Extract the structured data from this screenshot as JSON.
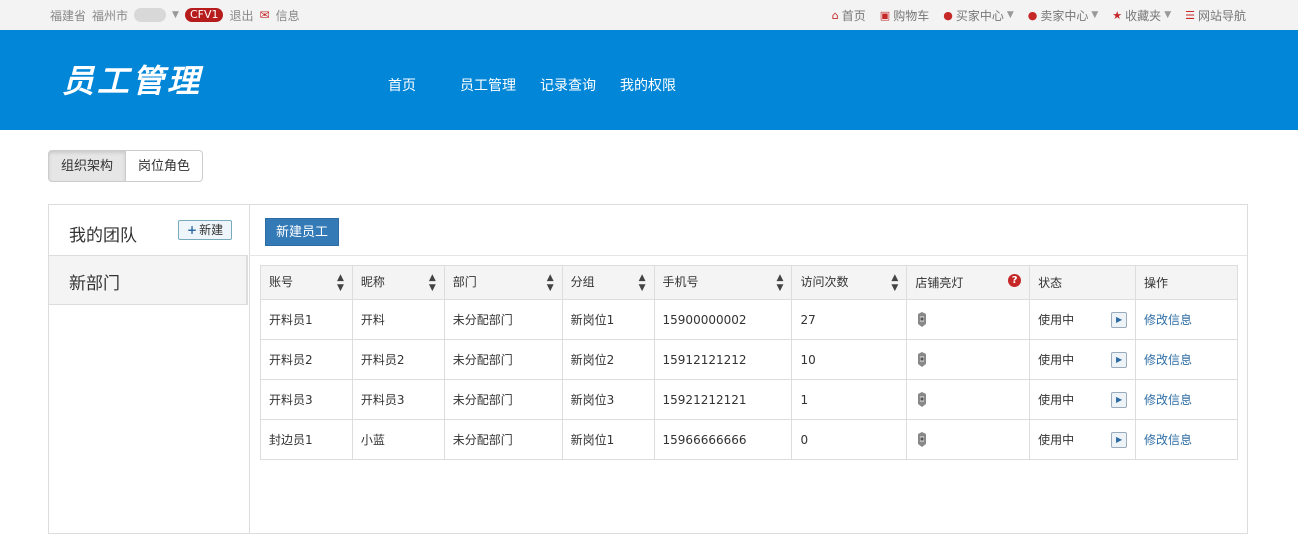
{
  "topbar": {
    "province": "福建省",
    "city": "福州市",
    "badge": "CFV1",
    "logout": "退出",
    "messages": "信息",
    "links": [
      {
        "label": "首页",
        "icon": "home-icon"
      },
      {
        "label": "购物车",
        "icon": "cart-icon"
      },
      {
        "label": "买家中心",
        "icon": "user-icon"
      },
      {
        "label": "卖家中心",
        "icon": "user-icon"
      },
      {
        "label": "收藏夹",
        "icon": "star-icon"
      },
      {
        "label": "网站导航",
        "icon": "list-icon"
      }
    ]
  },
  "header": {
    "logo": "员工管理",
    "nav": [
      "首页",
      "员工管理",
      "记录查询",
      "我的权限"
    ]
  },
  "tabs": [
    "组织架构",
    "岗位角色"
  ],
  "sidebar": {
    "title": "我的团队",
    "new_label": "新建",
    "department": "新部门"
  },
  "toolbar": {
    "add_employee": "新建员工"
  },
  "table": {
    "headers": [
      "账号",
      "昵称",
      "部门",
      "分组",
      "手机号",
      "访问次数",
      "店铺亮灯",
      "状态",
      "操作"
    ],
    "rows": [
      [
        "开料员1",
        "开料",
        "未分配部门",
        "新岗位1",
        "15900000002",
        "27",
        "",
        "使用中",
        "修改信息"
      ],
      [
        "开料员2",
        "开料员2",
        "未分配部门",
        "新岗位2",
        "15912121212",
        "10",
        "",
        "使用中",
        "修改信息"
      ],
      [
        "开料员3",
        "开料员3",
        "未分配部门",
        "新岗位3",
        "15921212121",
        "1",
        "",
        "使用中",
        "修改信息"
      ],
      [
        "封边员1",
        "小蓝",
        "未分配部门",
        "新岗位1",
        "15966666666",
        "0",
        "",
        "使用中",
        "修改信息"
      ]
    ]
  },
  "colors": {
    "brand": "#0286d7",
    "primary": "#337ab7",
    "accent": "#c62828"
  }
}
